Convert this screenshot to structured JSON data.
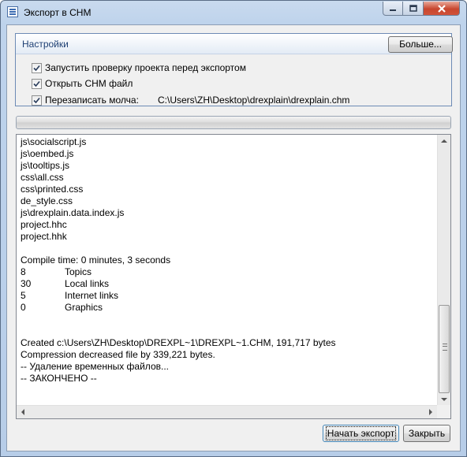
{
  "window": {
    "title": "Экспорт в CHM"
  },
  "settings": {
    "title": "Настройки",
    "more_button": "Больше...",
    "options": [
      {
        "label": "Запустить проверку проекта перед экспортом",
        "checked": true
      },
      {
        "label": "Открыть CHM файл",
        "checked": true
      },
      {
        "label": "Перезаписать молча:",
        "checked": true
      }
    ],
    "path": "C:\\Users\\ZH\\Desktop\\drexplain\\drexplain.chm"
  },
  "log": {
    "files": [
      "js\\socialscript.js",
      "js\\oembed.js",
      "js\\tooltips.js",
      "css\\all.css",
      "css\\printed.css",
      "de_style.css",
      "js\\drexplain.data.index.js",
      "project.hhc",
      "project.hhk"
    ],
    "compile_time": "Compile time: 0 minutes, 3 seconds",
    "stats": [
      {
        "count": "8",
        "label": "Topics"
      },
      {
        "count": "30",
        "label": "Local links"
      },
      {
        "count": "5",
        "label": "Internet links"
      },
      {
        "count": "0",
        "label": "Graphics"
      }
    ],
    "created": "Created c:\\Users\\ZH\\Desktop\\DREXPL~1\\DREXPL~1.CHM, 191,717 bytes",
    "compression": "Compression decreased file by 339,221 bytes.",
    "cleanup": "-- Удаление временных файлов...",
    "done": "-- ЗАКОНЧЕНО --"
  },
  "buttons": {
    "start": "Начать экспорт",
    "close": "Закрыть"
  }
}
